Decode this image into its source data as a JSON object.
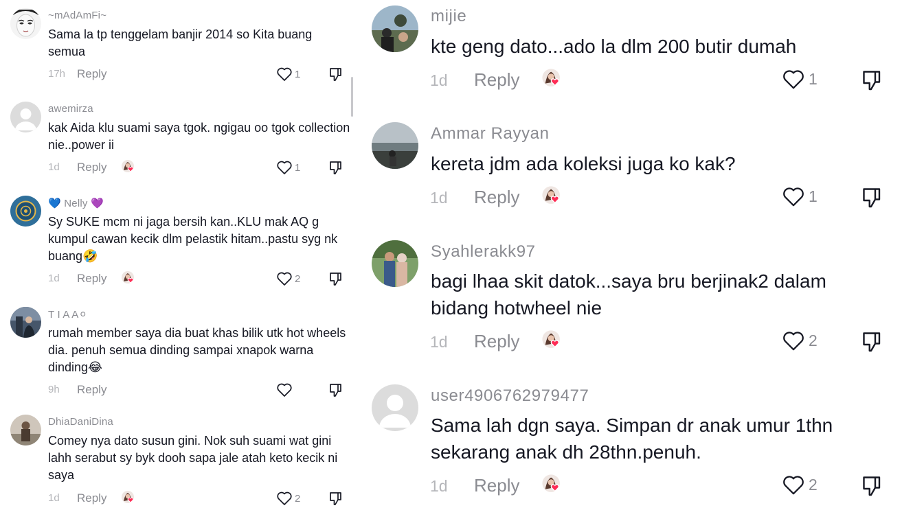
{
  "left_comments": [
    {
      "username": "~mAdAmFi~",
      "text": "Sama la tp tenggelam banjir 2014 so Kita buang semua",
      "time": "17h",
      "reply": "Reply",
      "likes": "1",
      "creator_liked": false
    },
    {
      "username": "awemirza",
      "text": "kak Aida klu suami saya tgok. ngigau oo tgok collection nie..power ii",
      "time": "1d",
      "reply": "Reply",
      "likes": "1",
      "creator_liked": true
    },
    {
      "username": "💙 Nelly 💜",
      "text": "Sy SUKE mcm ni jaga bersih kan..KLU mak AQ g kumpul cawan kecik dlm pelastik hitam..pastu syg nk buang🤣",
      "time": "1d",
      "reply": "Reply",
      "likes": "2",
      "creator_liked": true
    },
    {
      "username": "T I A A⚪",
      "text": "rumah member saya dia buat khas bilik utk hot wheels dia. penuh semua dinding sampai xnapok warna dinding😂",
      "time": "9h",
      "reply": "Reply",
      "likes": "",
      "creator_liked": false
    },
    {
      "username": "DhiaDaniDina",
      "text": "Comey nya dato susun gini. Nok suh suami wat gini lahh serabut sy byk dooh sapa jale atah keto kecik ni saya",
      "time": "1d",
      "reply": "Reply",
      "likes": "2",
      "creator_liked": true
    }
  ],
  "right_comments": [
    {
      "username": "mijie",
      "text": "kte geng dato...ado la dlm 200 butir dumah",
      "time": "1d",
      "reply": "Reply",
      "likes": "1",
      "creator_liked": true
    },
    {
      "username": "Ammar Rayyan",
      "text": "kereta jdm ada koleksi juga ko kak?",
      "time": "1d",
      "reply": "Reply",
      "likes": "1",
      "creator_liked": true
    },
    {
      "username": "Syahlerakk97",
      "text": "bagi lhaa skit datok...saya bru berjinak2 dalam bidang hotwheel nie",
      "time": "1d",
      "reply": "Reply",
      "likes": "2",
      "creator_liked": true
    },
    {
      "username": "user4906762979477",
      "text": "Sama lah dgn saya. Simpan dr anak umur 1thn sekarang anak dh 28thn.penuh.",
      "time": "1d",
      "reply": "Reply",
      "likes": "2",
      "creator_liked": true
    }
  ],
  "icons": {
    "like": "heart-outline-icon",
    "dislike": "thumbs-down-icon",
    "creator_badge": "creator-liked-avatar-icon"
  },
  "colors": {
    "text": "#161823",
    "meta": "#8a8b91",
    "time": "#b5b6ba",
    "heart_badge": "#fe2c55"
  }
}
